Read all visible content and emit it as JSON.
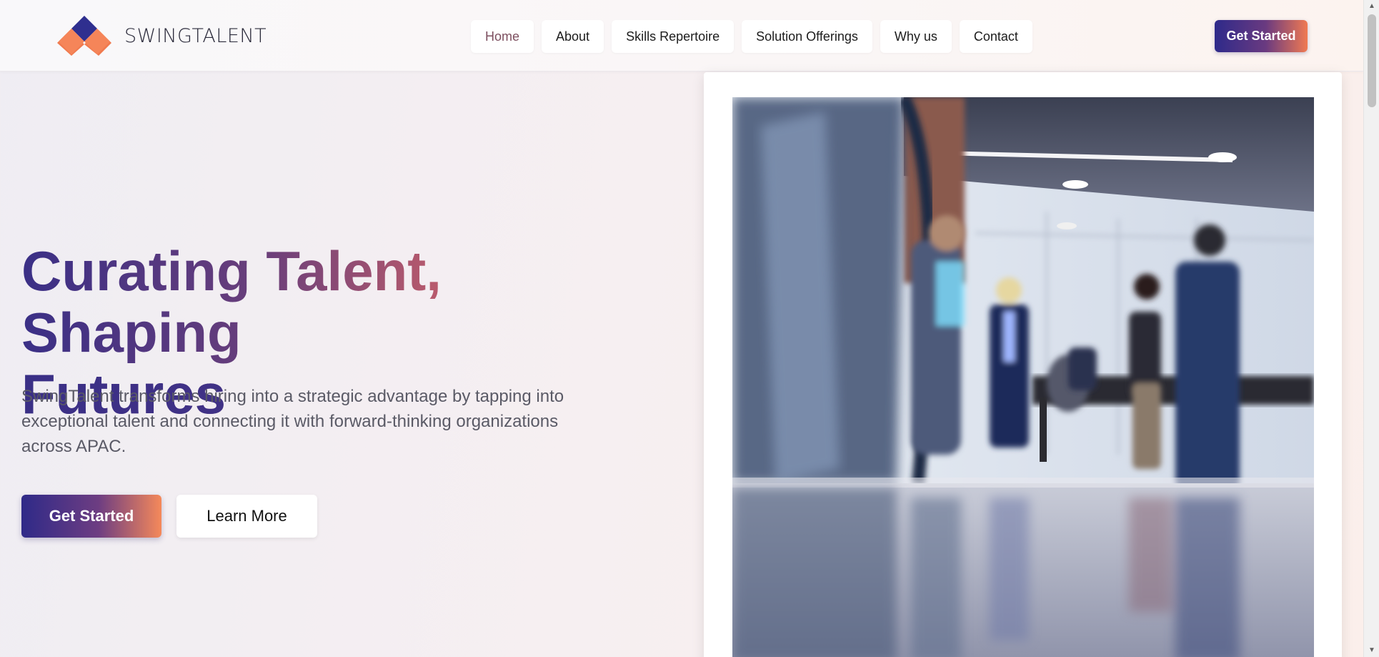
{
  "brand": {
    "logo_text": "SWINGTALENT"
  },
  "nav": {
    "items": [
      {
        "label": "Home",
        "active": true
      },
      {
        "label": "About",
        "active": false
      },
      {
        "label": "Skills Repertoire",
        "active": false
      },
      {
        "label": "Solution Offerings",
        "active": false
      },
      {
        "label": "Why us",
        "active": false
      },
      {
        "label": "Contact",
        "active": false
      }
    ],
    "cta_label": "Get Started"
  },
  "hero": {
    "title_line1": "Curating Talent, Shaping",
    "title_line2": "Futures",
    "description": "SwingTalent transforms hiring into a strategic advantage by tapping into exceptional talent and connecting it with forward-thinking organizations across APAC.",
    "primary_button": "Get Started",
    "secondary_button": "Learn More"
  },
  "icons": {
    "logo": "diamond-logo-icon",
    "scroll_up": "scroll-up-arrow-icon",
    "scroll_down": "scroll-down-arrow-icon"
  },
  "colors": {
    "brand_navy": "#2e2a8a",
    "brand_orange": "#f58a55",
    "nav_active": "#7d4f5f"
  }
}
